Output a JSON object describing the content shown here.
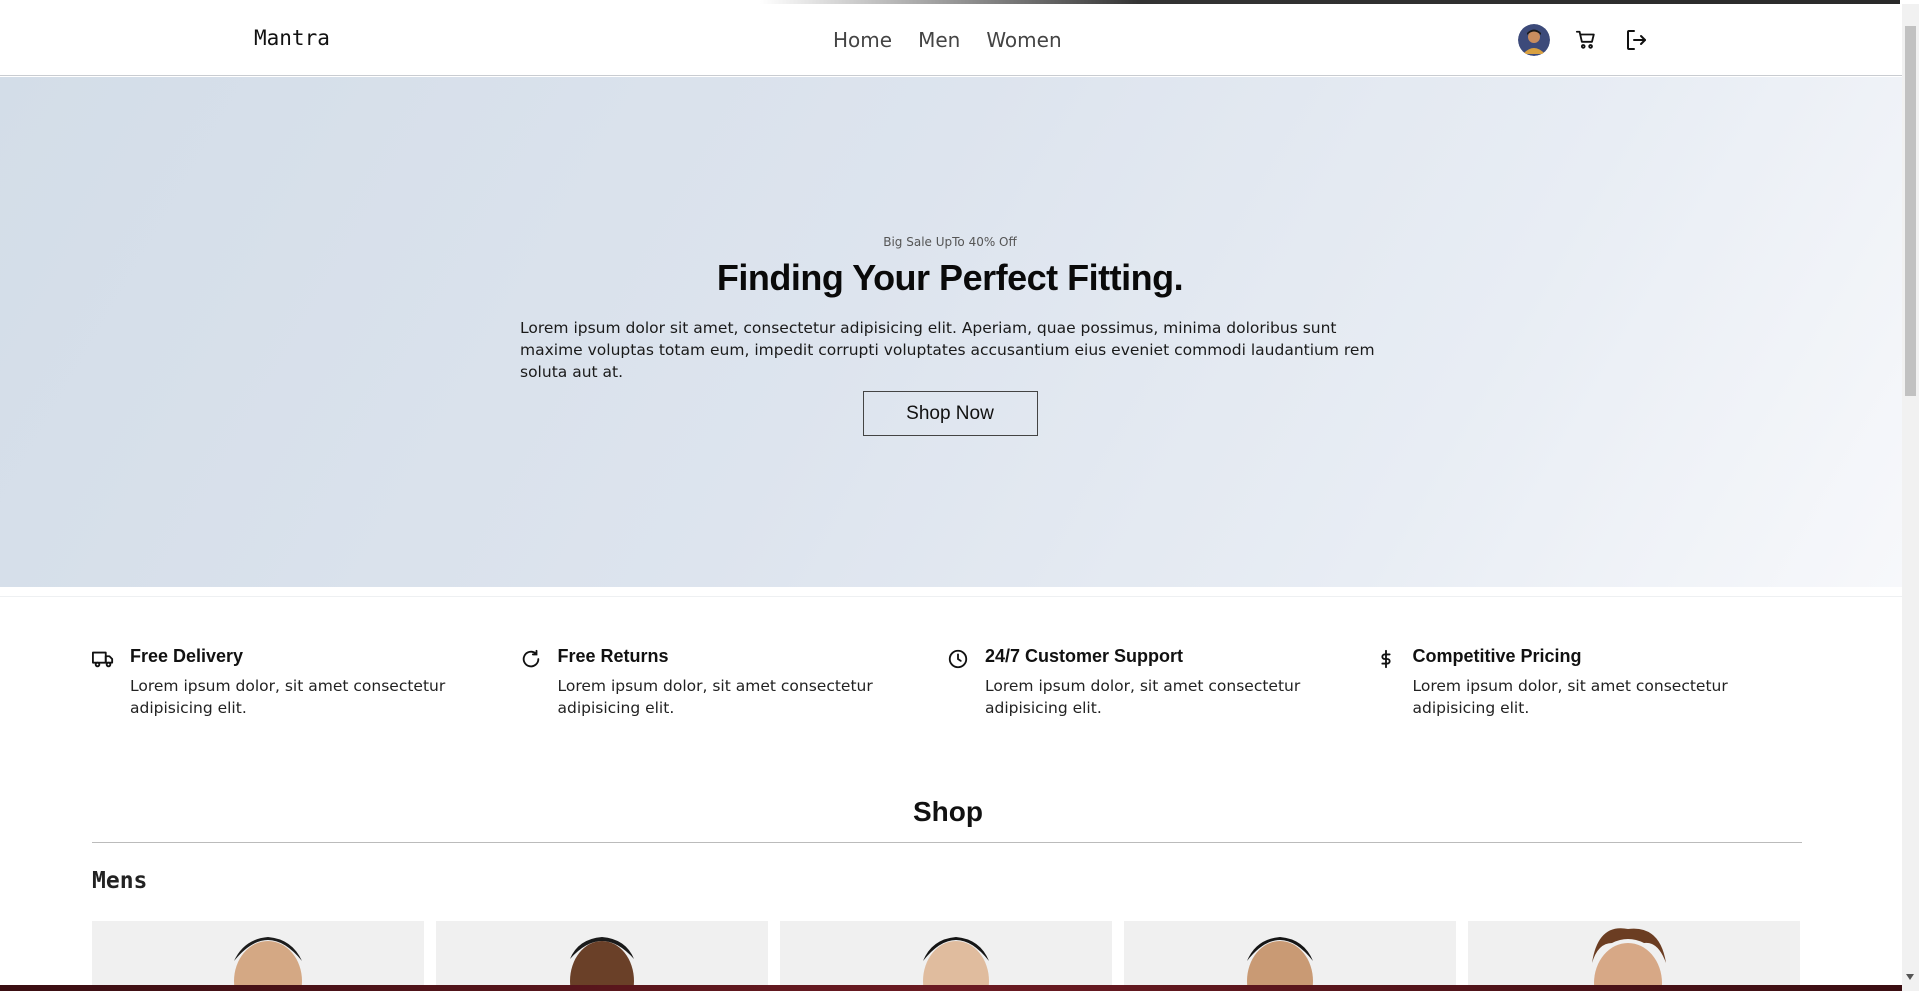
{
  "navbar": {
    "brand": "Mantra",
    "links": [
      "Home",
      "Men",
      "Women"
    ],
    "icons": [
      "avatar",
      "cart-icon",
      "logout-icon"
    ]
  },
  "hero": {
    "kicker": "Big Sale UpTo 40% Off",
    "title": "Finding Your Perfect Fitting.",
    "text": "Lorem ipsum dolor sit amet, consectetur adipisicing elit. Aperiam, quae possimus, minima doloribus sunt maxime voluptas totam eum, impedit corrupti voluptates accusantium eius eveniet commodi laudantium rem soluta aut at.",
    "button": "Shop Now"
  },
  "features": [
    {
      "icon": "truck-icon",
      "title": "Free Delivery",
      "text": "Lorem ipsum dolor, sit amet consectetur adipisicing elit."
    },
    {
      "icon": "refresh-icon",
      "title": "Free Returns",
      "text": "Lorem ipsum dolor, sit amet consectetur adipisicing elit."
    },
    {
      "icon": "clock-icon",
      "title": "24/7 Customer Support",
      "text": "Lorem ipsum dolor, sit amet consectetur adipisicing elit."
    },
    {
      "icon": "dollar-icon",
      "title": "Competitive Pricing",
      "text": "Lorem ipsum dolor, sit amet consectetur adipisicing elit."
    }
  ],
  "shop": {
    "heading": "Shop",
    "section": "Mens",
    "products_visible": 5
  },
  "colors": {
    "hero_start": "#d3dde8",
    "hero_end": "#f7f8fb",
    "card_bg": "#f0f0f0",
    "text": "#111111"
  }
}
